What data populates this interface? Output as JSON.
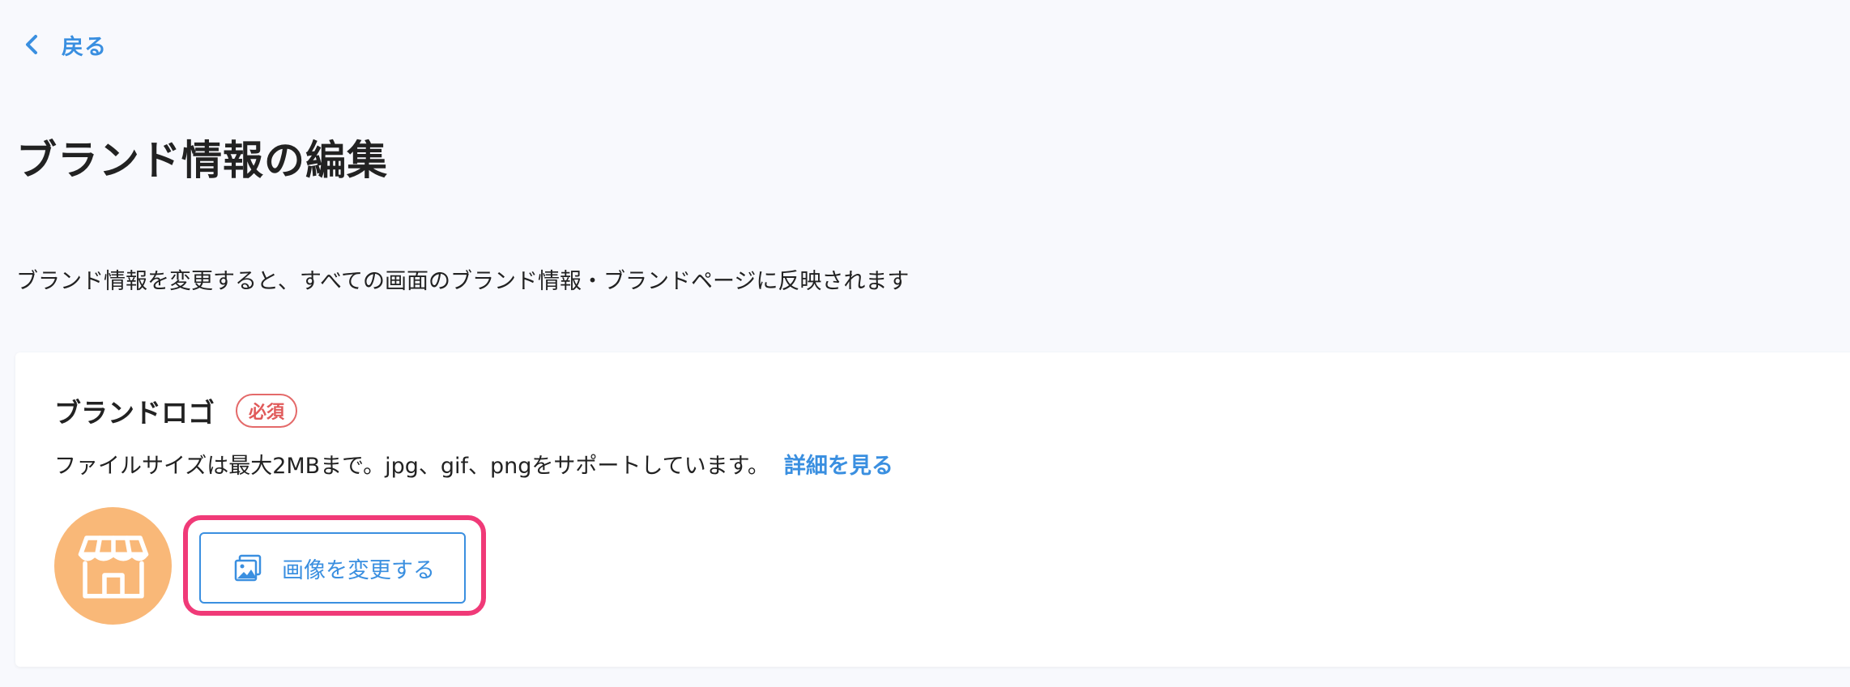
{
  "nav": {
    "back_label": "戻る",
    "back_icon": "chevron-left-icon"
  },
  "page": {
    "title": "ブランド情報の編集",
    "description": "ブランド情報を変更すると、すべての画面のブランド情報・ブランドページに反映されます"
  },
  "logo_field": {
    "label": "ブランドロゴ",
    "required_badge": "必須",
    "help_text": "ファイルサイズは最大2MBまで。jpg、gif、pngをサポートしています。",
    "help_link": "詳細を見る",
    "avatar_icon": "store-icon",
    "change_button_label": "画像を変更する",
    "change_button_icon": "image-icon"
  },
  "colors": {
    "background": "#f8f9fd",
    "accent": "#3a8fe0",
    "required": "#e05a5a",
    "avatar": "#f9b878",
    "highlight": "#f03a78",
    "text": "#222222"
  }
}
